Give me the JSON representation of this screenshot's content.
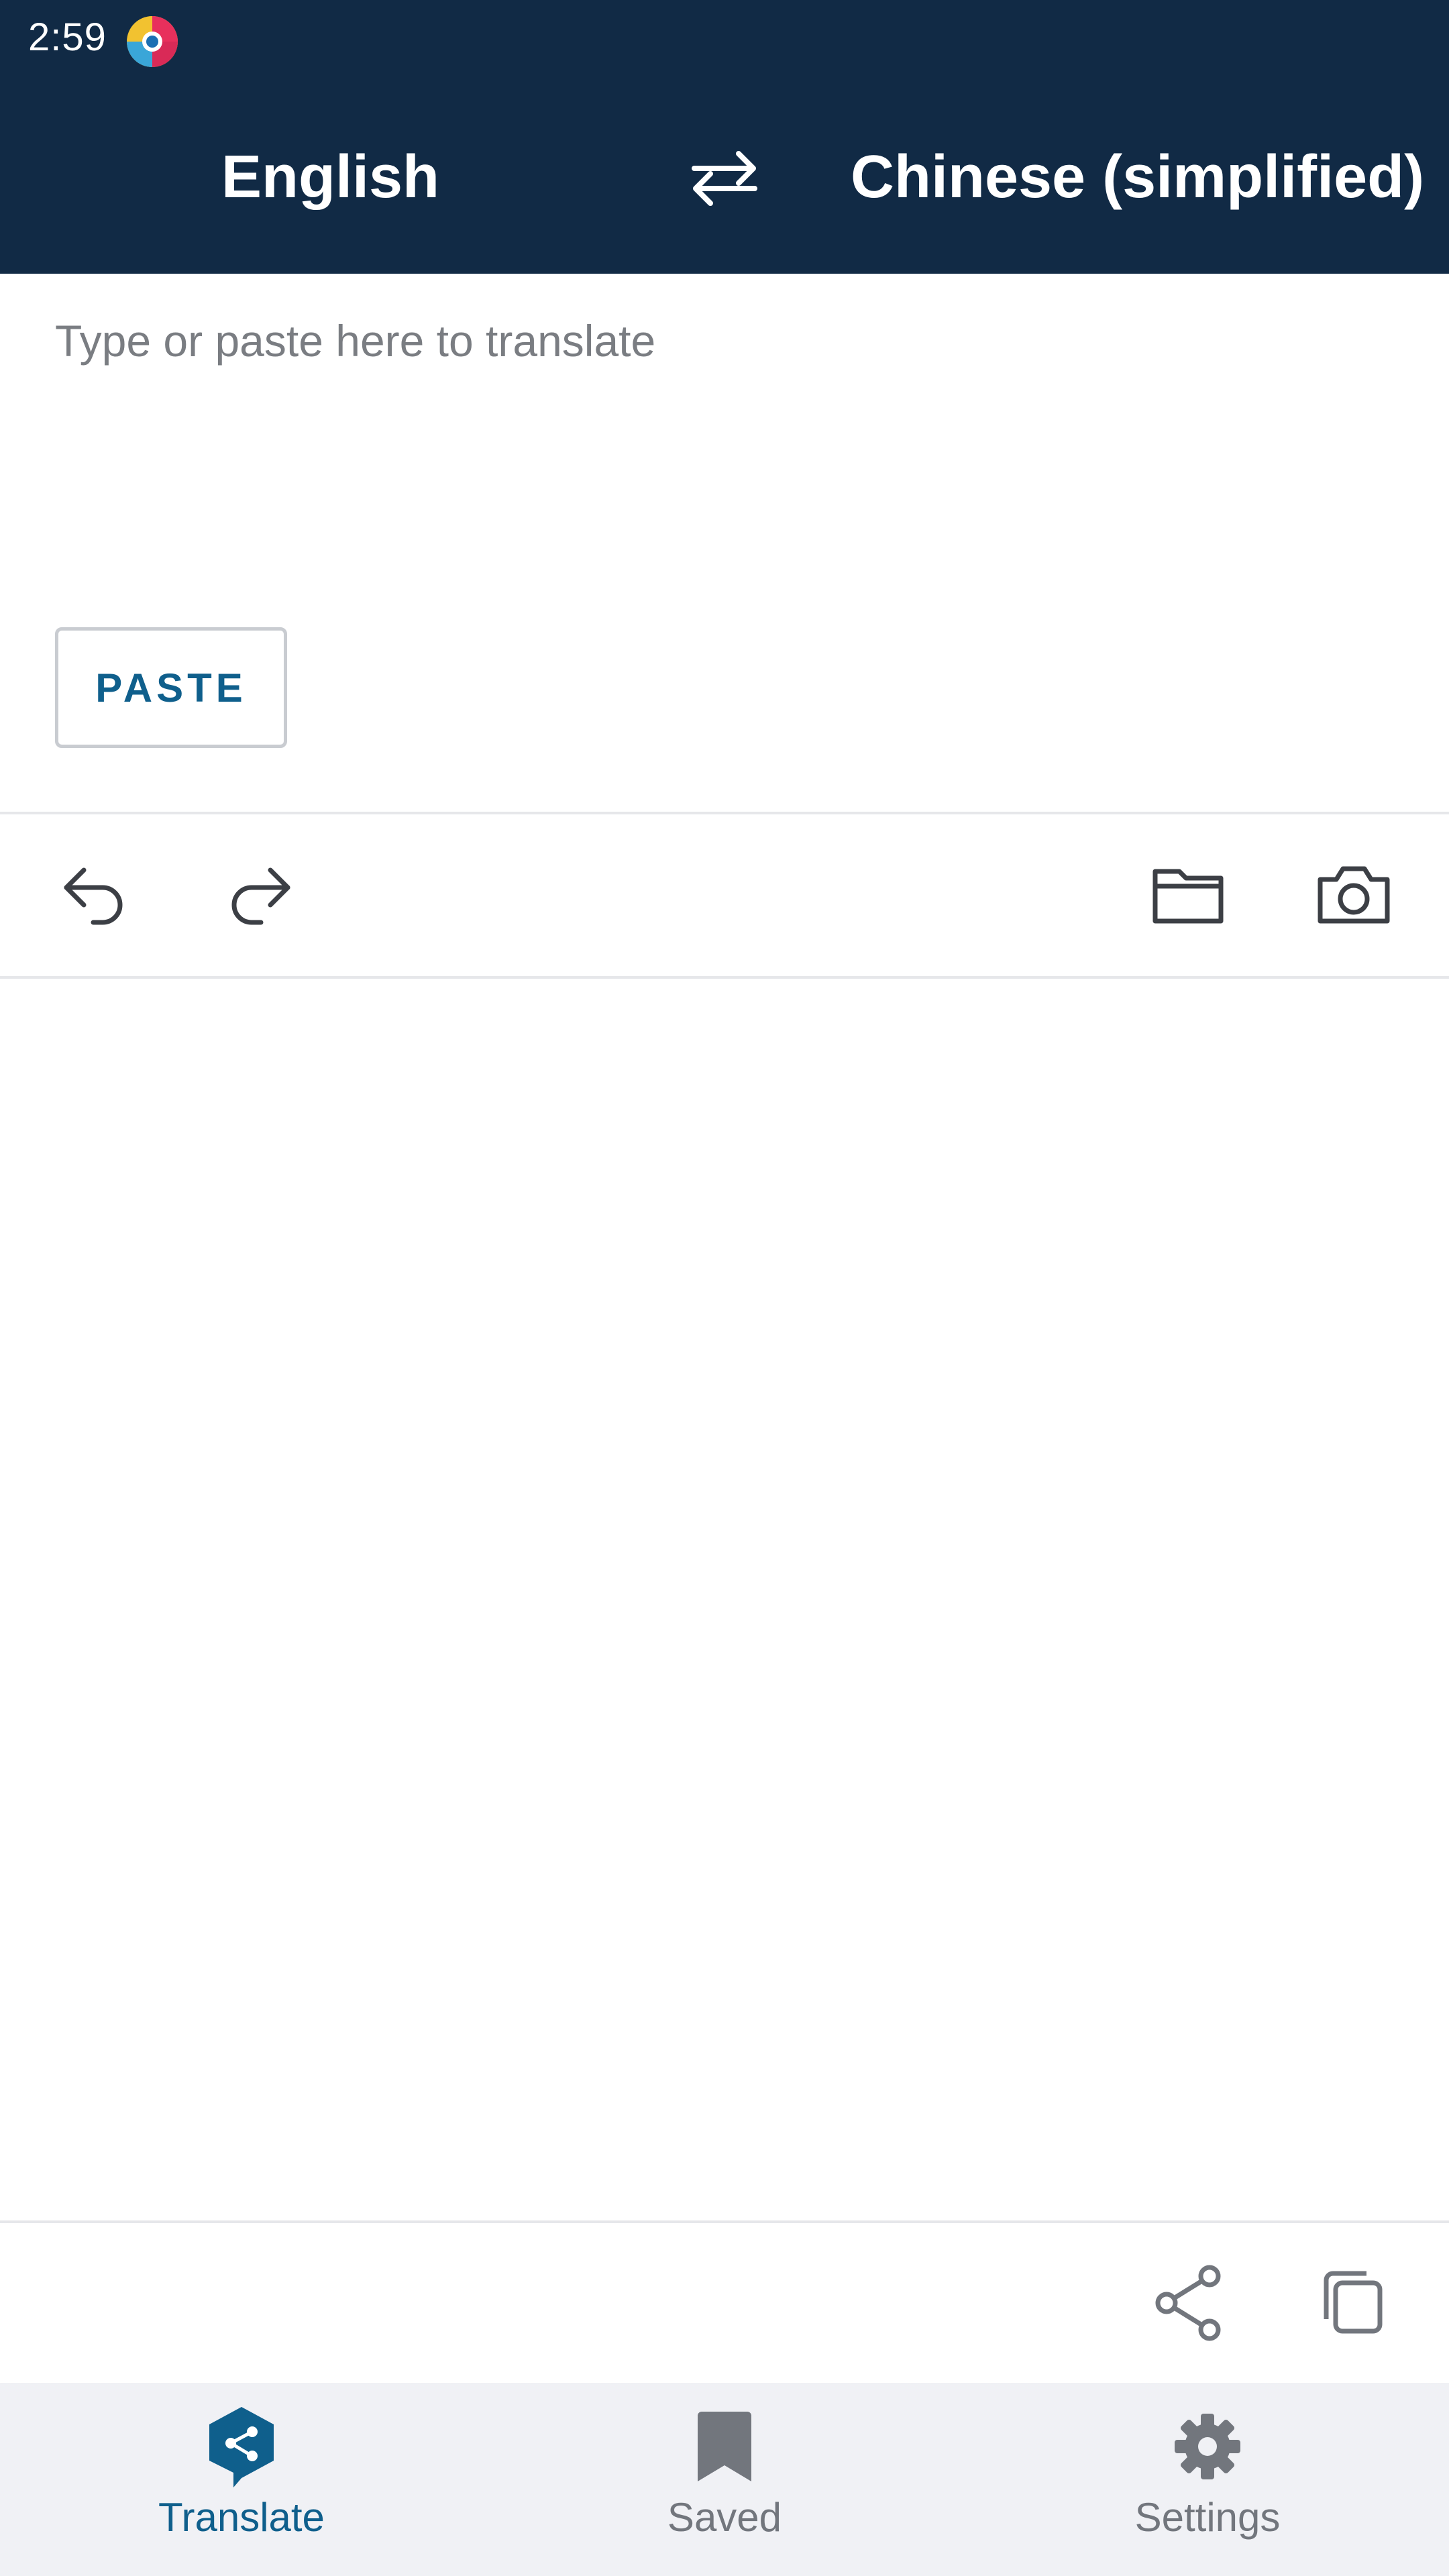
{
  "status_bar": {
    "time": "2:59"
  },
  "header": {
    "source_language": "English",
    "target_language": "Chinese (simplified)",
    "swap_icon": "swap-arrows-icon"
  },
  "input": {
    "value": "",
    "placeholder": "Type or paste here to translate",
    "paste_label": "PASTE"
  },
  "toolbar": {
    "icons": [
      "undo-icon",
      "redo-icon",
      "folder-icon",
      "camera-icon"
    ]
  },
  "output_actions": {
    "icons": [
      "share-icon",
      "copy-icon"
    ]
  },
  "bottom_nav": {
    "active": "Translate",
    "items": [
      {
        "label": "Translate",
        "icon": "translate-icon"
      },
      {
        "label": "Saved",
        "icon": "bookmark-icon"
      },
      {
        "label": "Settings",
        "icon": "gear-icon"
      }
    ]
  },
  "colors": {
    "header_bg": "#112a45",
    "accent": "#0f5f8c",
    "icon_dark": "#3c3f45",
    "icon_muted": "#72767d",
    "nav_bg": "#f0f1f5",
    "divider": "#e6e7ea"
  }
}
